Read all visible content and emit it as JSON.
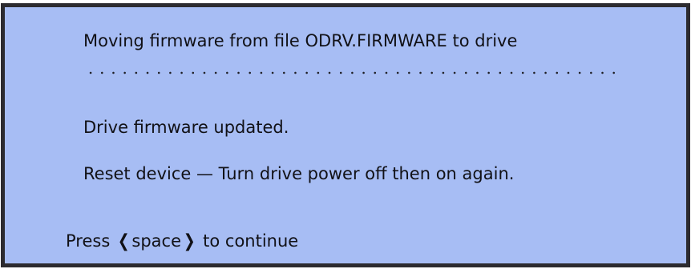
{
  "dialog": {
    "message_line": "Moving firmware from file ODRV.FIRMWARE to drive",
    "status_line": "Drive firmware updated.",
    "instruction_line": "Reset device — Turn drive power off then on again.",
    "prompt": {
      "prefix": "Press",
      "key_open": "❮",
      "key_name": "space",
      "key_close": "❯",
      "suffix": "to continue"
    },
    "progress": 1.0
  },
  "colors": {
    "background": "#a7bdf4",
    "border": "#2c2b2f",
    "text": "#111116"
  }
}
